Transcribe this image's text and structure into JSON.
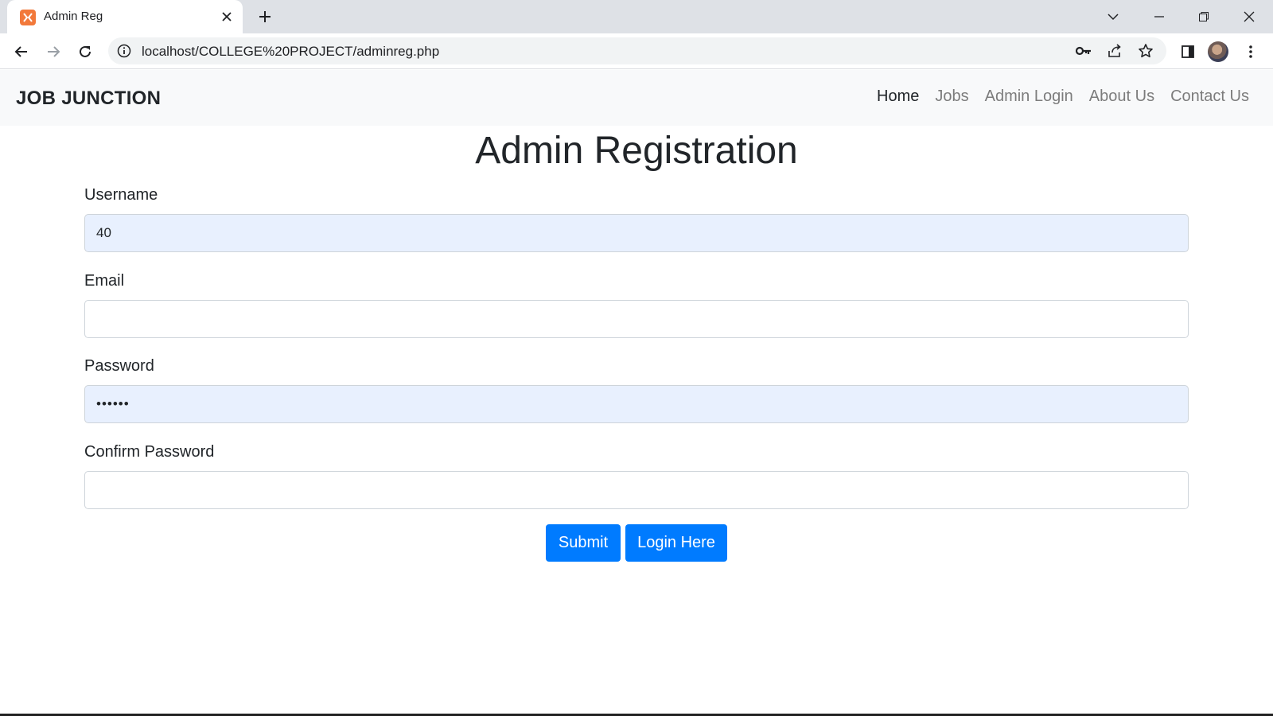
{
  "browser": {
    "tab_title": "Admin Reg",
    "url": "localhost/COLLEGE%20PROJECT/adminreg.php",
    "icons": [
      "xampp-favicon-icon",
      "close-icon",
      "plus-icon",
      "chevron-down-icon",
      "minimize-icon",
      "restore-icon",
      "close-window-icon",
      "back-arrow-icon",
      "forward-arrow-icon",
      "reload-icon",
      "info-icon",
      "key-icon",
      "share-icon",
      "star-icon",
      "side-panel-icon",
      "kebab-menu-icon"
    ]
  },
  "navbar": {
    "brand": "JOB JUNCTION",
    "links": [
      "Home",
      "Jobs",
      "Admin Login",
      "About Us",
      "Contact Us"
    ]
  },
  "form": {
    "title": "Admin Registration",
    "username_label": "Username",
    "username_value": "40",
    "email_label": "Email",
    "email_value": "",
    "password_label": "Password",
    "password_value": "••••••",
    "confirm_label": "Confirm Password",
    "confirm_value": "",
    "submit_label": "Submit",
    "login_label": "Login Here"
  },
  "colors": {
    "primary": "#007bff",
    "navbar_bg": "#f8f9fa",
    "autofill_bg": "#e8f0fe"
  }
}
